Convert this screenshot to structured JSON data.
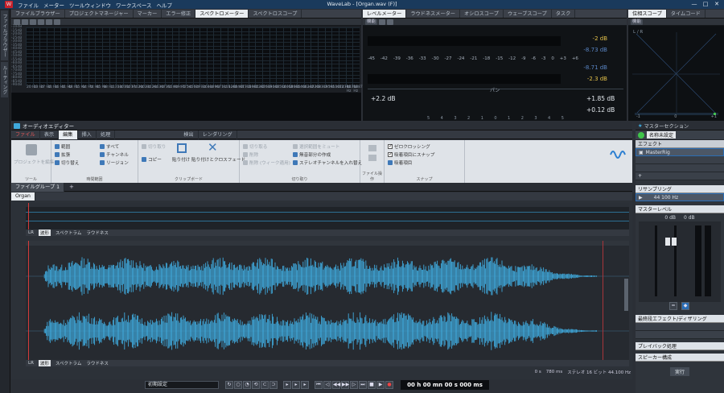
{
  "app": {
    "title": "WaveLab - [Organ.wav (F)]",
    "menu": [
      "ファイル",
      "メーター",
      "ツールウィンドウ",
      "ワークスペース",
      "ヘルプ"
    ],
    "win_buttons": [
      "—",
      "□",
      "✕"
    ]
  },
  "left_tabs": [
    "ファイルブラウザー",
    "ルーティング"
  ],
  "top_tabs": [
    "ファイルブラウザー",
    "プロジェクトマネージャー",
    "マーカー",
    "エラー修正",
    "スペクトロメーター",
    "スペクトロスコープ"
  ],
  "spectrum": {
    "y_labels": [
      "-10dB",
      "-15dB",
      "-20dB",
      "-25dB",
      "-30dB",
      "-35dB",
      "-40dB",
      "-45dB",
      "-50dB",
      "-55dB",
      "-60dB",
      "-65dB",
      "-70dB",
      "-75dB",
      "-80dB",
      "-85dB",
      "-90dB"
    ],
    "x_labels": [
      "20 Hz",
      "23 Hz",
      "27 Hz",
      "31 Hz",
      "36 Hz",
      "41 Hz",
      "48 Hz",
      "55 Hz",
      "64 Hz",
      "74 Hz",
      "85 Hz",
      "98 Hz",
      "113 Hz",
      "130 Hz",
      "150 Hz",
      "174 Hz",
      "200 Hz",
      "231 Hz",
      "266 Hz",
      "307 Hz",
      "355 Hz",
      "409 Hz",
      "472 Hz",
      "545 Hz",
      "629 Hz",
      "726 Hz",
      "838 Hz",
      "967 Hz",
      "1116 Hz",
      "1288 Hz",
      "1487 Hz",
      "1716 Hz",
      "1981 Hz",
      "2287 Hz",
      "2639 Hz",
      "3046 Hz",
      "3516 Hz",
      "4058 Hz",
      "4684 Hz",
      "5406 Hz",
      "6240 Hz",
      "7202 Hz",
      "8313 Hz",
      "9595 Hz",
      "11074 Hz",
      "12781 Hz",
      "14752 Hz",
      "16874 Hz"
    ]
  },
  "meter_tabs": [
    "レベルメーター",
    "ラウドネスメーター",
    "オシロスコープ",
    "ウェーブスコープ",
    "タスク"
  ],
  "level_meter": {
    "scale": [
      "-45",
      "-42",
      "-39",
      "-36",
      "-33",
      "-30",
      "-27",
      "-24",
      "-21",
      "-18",
      "-15",
      "-12",
      "-9",
      "-6",
      "-3",
      "0",
      "+3",
      "+6"
    ],
    "values": [
      "-2 dB",
      "-8.73 dB",
      "-8.71 dB",
      "-2.3 dB"
    ],
    "pan_label": "パン",
    "pan_left": "+2.2 dB",
    "pan_right_1": "+1.85 dB",
    "pan_right_2": "+0.12 dB",
    "pan_scale": [
      "5",
      "4",
      "3",
      "2",
      "1",
      "0",
      "1",
      "2",
      "3",
      "4",
      "5"
    ],
    "tool_label": "機能"
  },
  "phase_tabs": [
    "位相スコープ",
    "タイムコード"
  ],
  "phase_scope": {
    "tool_label": "機能",
    "label": "L / R",
    "scale": [
      "-1",
      "0",
      "+1"
    ]
  },
  "editor": {
    "title": "オーディオエディター",
    "ribbon_tabs": [
      "ファイル",
      "表示",
      "編集",
      "挿入",
      "処理",
      "検出",
      "レンダリング"
    ],
    "groups": {
      "g1": {
        "cap": "ツール",
        "items": [
          "プロジェクトを編集"
        ]
      },
      "g2": {
        "cap": "時間範囲",
        "items": [
          "範囲",
          "すべて",
          "拡張",
          "チャンネル",
          "切り替え",
          "リージョン"
        ]
      },
      "g3": {
        "cap": "クリップボード",
        "items": [
          "切り取り",
          "コピー",
          "貼り付け",
          "貼り付けとクロスフェード"
        ]
      },
      "g4": {
        "cap": "切り取り",
        "items": [
          "切り取る",
          "削除",
          "削除 (ウィーク適用)",
          "選択範囲をミュート",
          "無音部分の作成",
          "ステレオチャンネルを入れ替え"
        ]
      },
      "g5": {
        "cap": "ファイル操作",
        "items": []
      },
      "g6": {
        "cap": "スナップ",
        "items": [
          "ゼロクロッシング",
          "吸着項目にスナップ",
          "吸着項目"
        ]
      }
    },
    "file_group": "ファイルグループ 1",
    "file_tab": "Organ",
    "overview_bar": [
      "LR",
      "波形",
      "スペクトラム",
      "ラウドネス"
    ],
    "main_bar": [
      "LR",
      "波形",
      "スペクトラム",
      "ラウドネス"
    ],
    "status": {
      "pos": "0 s",
      "zoom": "780 ms",
      "info": "ステレオ 16 ビット 44.100 Hz"
    }
  },
  "master": {
    "title": "マスターセクション",
    "preset": "名称未設定",
    "effects": "エフェクト",
    "plugin": "MasterRig",
    "resampling": "リサンプリング",
    "rate": "44 100 Hz",
    "level": "マスターレベル",
    "db_l": "0 dB",
    "db_r": "0 dB",
    "final": "最終段エフェクト/ディザリング",
    "playback": "プレイバック処理",
    "speaker": "スピーカー構成",
    "render": "実行"
  },
  "transport": {
    "preset": "初期設定",
    "time": "00 h 00 mn 00 s 000 ms"
  },
  "colors": {
    "wave": "#3fa9dc",
    "accent": "#1a3a5c",
    "cursor": "#d43a3a"
  }
}
